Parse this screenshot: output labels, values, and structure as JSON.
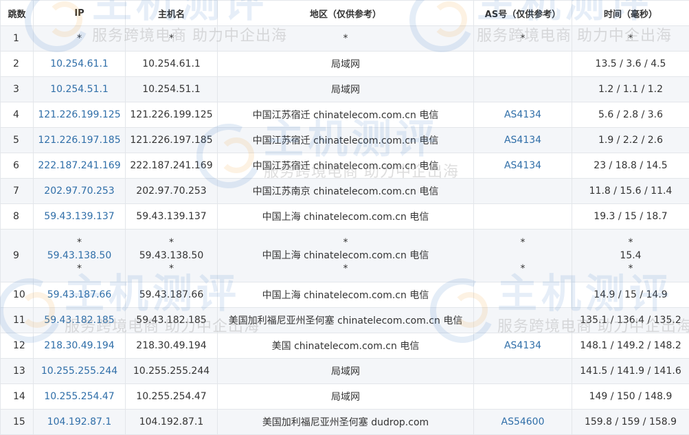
{
  "headers": {
    "hop": "跳数",
    "ip": "IP",
    "host": "主机名",
    "region": "地区（仅供参考）",
    "as": "AS号（仅供参考）",
    "time": "时间（毫秒）"
  },
  "watermark": {
    "brand": "主机测评",
    "slogan": "服务跨境电商 助力中企出海"
  },
  "rows": [
    {
      "hop": "1",
      "ip": "*",
      "host": "*",
      "region": "*",
      "as": "*",
      "time": "*"
    },
    {
      "hop": "2",
      "ip": "10.254.61.1",
      "host": "10.254.61.1",
      "region": "局域网",
      "as": "",
      "time": "13.5 / 3.6 / 4.5"
    },
    {
      "hop": "3",
      "ip": "10.254.51.1",
      "host": "10.254.51.1",
      "region": "局域网",
      "as": "",
      "time": "1.2 / 1.1 / 1.2"
    },
    {
      "hop": "4",
      "ip": "121.226.199.125",
      "host": "121.226.199.125",
      "region": "中国江苏宿迁 chinatelecom.com.cn 电信",
      "as": "AS4134",
      "time": "5.6 / 2.8 / 3.6"
    },
    {
      "hop": "5",
      "ip": "121.226.197.185",
      "host": "121.226.197.185",
      "region": "中国江苏宿迁 chinatelecom.com.cn 电信",
      "as": "AS4134",
      "time": "1.9 / 2.2 / 2.6"
    },
    {
      "hop": "6",
      "ip": "222.187.241.169",
      "host": "222.187.241.169",
      "region": "中国江苏宿迁 chinatelecom.com.cn 电信",
      "as": "AS4134",
      "time": "23 / 18.8 / 14.5"
    },
    {
      "hop": "7",
      "ip": "202.97.70.253",
      "host": "202.97.70.253",
      "region": "中国江苏南京 chinatelecom.com.cn 电信",
      "as": "",
      "time": "11.8 / 15.6 / 11.4"
    },
    {
      "hop": "8",
      "ip": "59.43.139.137",
      "host": "59.43.139.137",
      "region": "中国上海 chinatelecom.com.cn 电信",
      "as": "",
      "time": "19.3 / 15 / 18.7"
    },
    {
      "hop": "9",
      "ip": [
        "*",
        "59.43.138.50",
        "*"
      ],
      "host": [
        "*",
        "59.43.138.50",
        "*"
      ],
      "region": [
        "*",
        "中国上海 chinatelecom.com.cn 电信",
        "*"
      ],
      "as": [
        "*",
        "",
        "*"
      ],
      "time": [
        "*",
        "15.4",
        "*"
      ]
    },
    {
      "hop": "10",
      "ip": "59.43.187.66",
      "host": "59.43.187.66",
      "region": "中国上海 chinatelecom.com.cn 电信",
      "as": "",
      "time": "14.9 / 15 / 14.9"
    },
    {
      "hop": "11",
      "ip": "59.43.182.185",
      "host": "59.43.182.185",
      "region": "美国加利福尼亚州圣何塞 chinatelecom.com.cn 电信",
      "as": "",
      "time": "135.1 / 136.4 / 135.2"
    },
    {
      "hop": "12",
      "ip": "218.30.49.194",
      "host": "218.30.49.194",
      "region": "美国 chinatelecom.com.cn 电信",
      "as": "AS4134",
      "time": "148.1 / 149.2 / 148.2"
    },
    {
      "hop": "13",
      "ip": "10.255.255.244",
      "host": "10.255.255.244",
      "region": "局域网",
      "as": "",
      "time": "141.5 / 141.9 / 141.6"
    },
    {
      "hop": "14",
      "ip": "10.255.254.47",
      "host": "10.255.254.47",
      "region": "局域网",
      "as": "",
      "time": "149 / 150 / 148.9"
    },
    {
      "hop": "15",
      "ip": "104.192.87.1",
      "host": "104.192.87.1",
      "region": "美国加利福尼亚州圣何塞 dudrop.com",
      "as": "AS54600",
      "time": "159.8 / 159 / 158.9"
    }
  ]
}
